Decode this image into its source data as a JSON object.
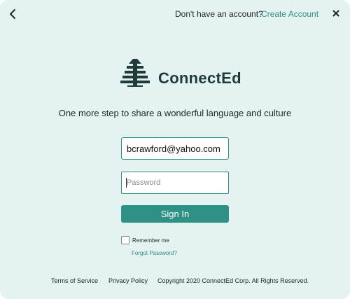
{
  "header": {
    "prompt_text": "Don't have an account?",
    "create_account_label": "Create Account"
  },
  "brand": {
    "name": "ConnectEd",
    "logo_icon": "pine-tree-logo-icon",
    "color": "#1e3c3a"
  },
  "tagline": "One more step to share a wonderful language and culture",
  "form": {
    "email_value": "bcrawford@yahoo.com",
    "password_placeholder": "Password",
    "signin_label": "Sign In",
    "remember_label": "Remember me",
    "remember_checked": false,
    "forgot_label": "Forgot Password?"
  },
  "footer": {
    "terms": "Terms of Service",
    "privacy": "Privacy Policy",
    "copyright": "Copyright 2020 ConnectEd Corp. All Rights Reserved."
  },
  "colors": {
    "background": "#e4f2f1",
    "accent": "#2e9185",
    "text": "#1d2424"
  },
  "icons": {
    "back": "chevron-left-icon",
    "close": "close-icon"
  }
}
